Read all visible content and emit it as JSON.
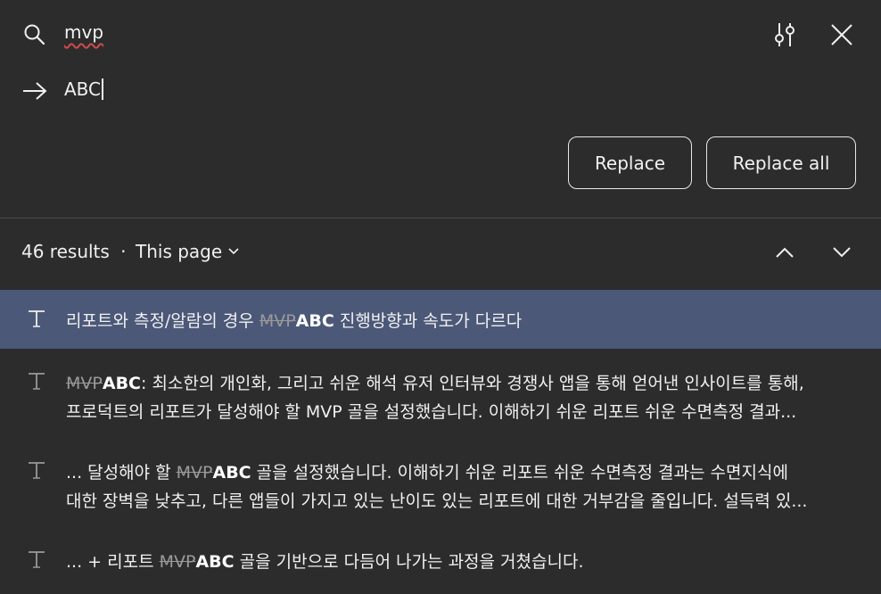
{
  "search": {
    "value": "mvp"
  },
  "replace": {
    "value": "ABC"
  },
  "buttons": {
    "replace": "Replace",
    "replace_all": "Replace all"
  },
  "summary": {
    "count": "46 results",
    "separator": "·",
    "scope": "This page"
  },
  "icons": {
    "search": "search-icon",
    "filters": "filter-sliders-icon",
    "close": "close-icon",
    "arrow": "arrow-right-icon",
    "prev": "chevron-up-icon",
    "next": "chevron-down-icon",
    "dropdown": "chevron-down-icon",
    "text": "text-type-icon"
  },
  "colors": {
    "background": "#2c2c2c",
    "selected_row": "#4b5878",
    "misspell_underline": "#d24a4a"
  },
  "results": [
    {
      "selected": true,
      "line1": {
        "before": "리포트와 측정/알람의 경우 ",
        "match": "MVP",
        "replacement": "ABC",
        "after": " 진행방향과 속도가 다르다"
      }
    },
    {
      "selected": false,
      "line1": {
        "before": "",
        "match": "MVP",
        "replacement": "ABC",
        "after": ": 최소한의 개인화, 그리고 쉬운 해석 유저 인터뷰와 경쟁사 앱을 통해 얻어낸 인사이트를 통해,"
      },
      "line2": "프로덕트의 리포트가 달성해야 할 MVP 골을 설정했습니다. 이해하기 쉬운 리포트 쉬운 수면측정 결과..."
    },
    {
      "selected": false,
      "line1": {
        "before": "... 달성해야 할 ",
        "match": "MVP",
        "replacement": "ABC",
        "after": " 골을 설정했습니다. 이해하기 쉬운 리포트 쉬운 수면측정 결과는 수면지식에"
      },
      "line2": "대한 장벽을 낮추고, 다른 앱들이 가지고 있는 난이도 있는 리포트에 대한 거부감을 줄입니다. 설득력 있..."
    },
    {
      "selected": false,
      "line1": {
        "before": "... + 리포트 ",
        "match": "MVP",
        "replacement": "ABC",
        "after": " 골을 기반으로 다듬어 나가는 과정을 거쳤습니다."
      }
    }
  ]
}
